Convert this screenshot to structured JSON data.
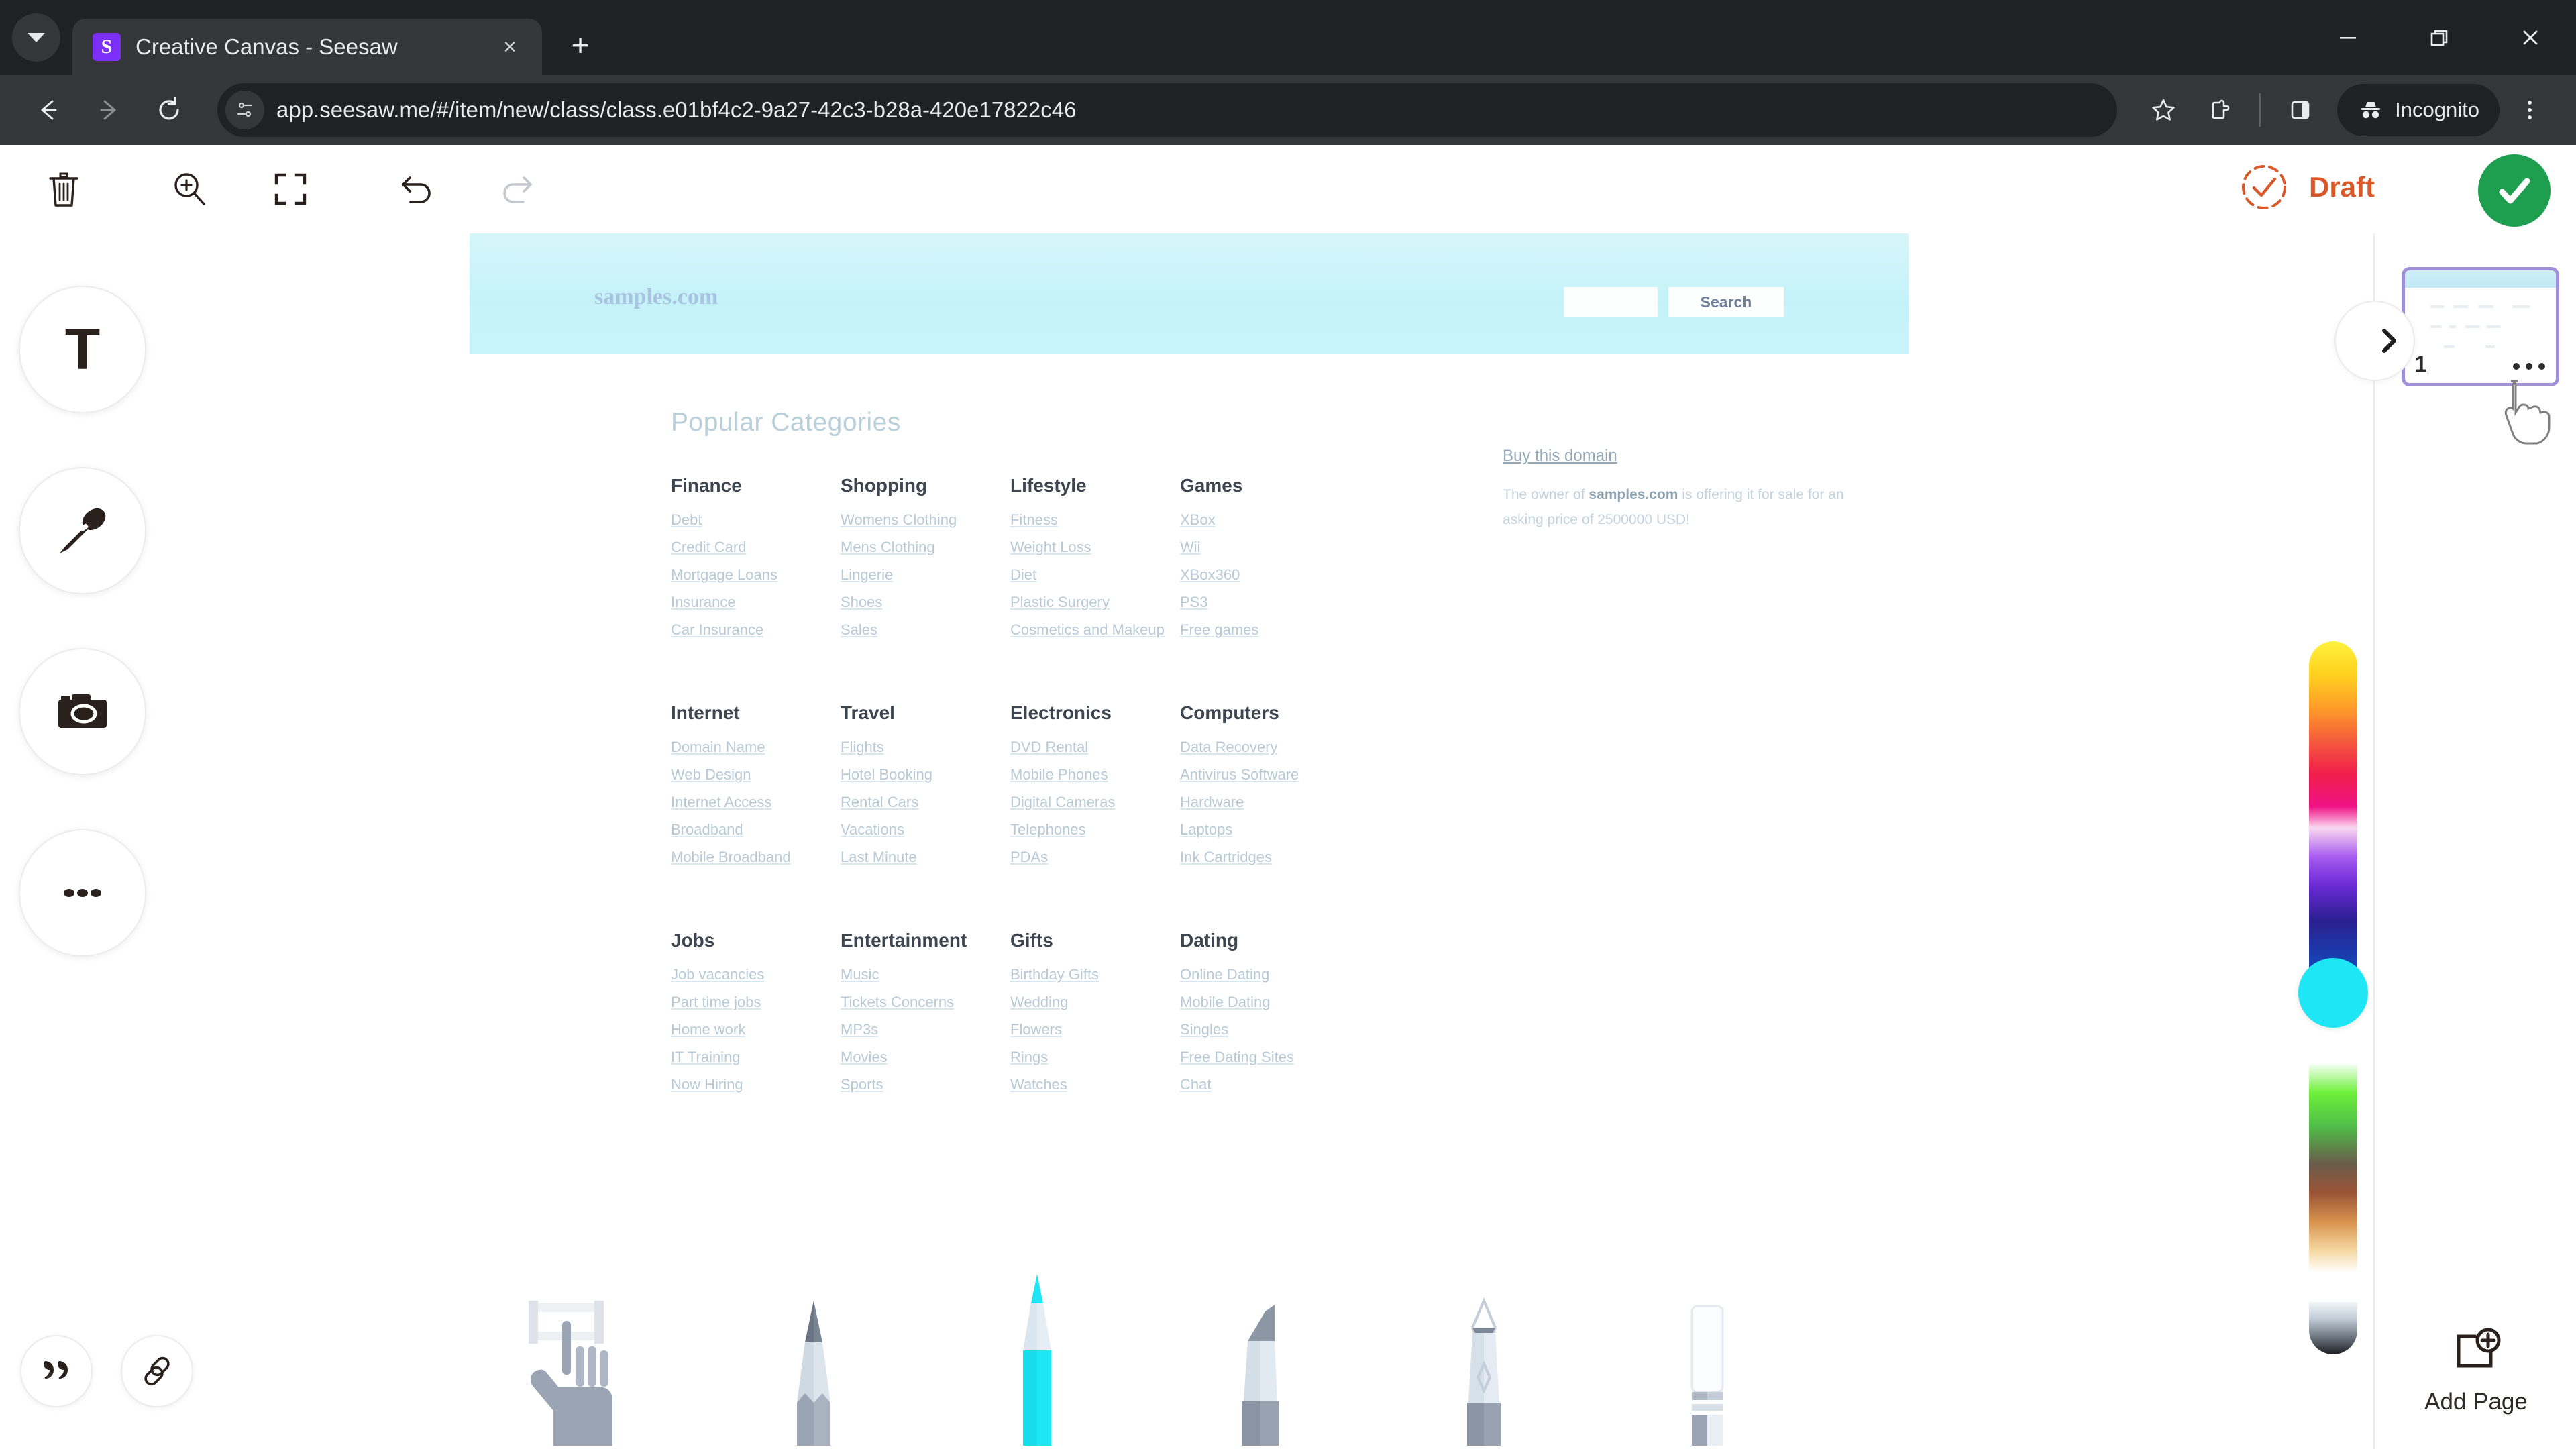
{
  "browser": {
    "tab": {
      "title": "Creative Canvas - Seesaw",
      "favicon_letter": "S",
      "favicon_name": "seesaw-logo"
    },
    "new_tab_label": "+",
    "close_label": "×",
    "url": "app.seesaw.me/#/item/new/class/class.e01bf4c2-9a27-42c3-b28a-420e17822c46",
    "profile_label": "Incognito",
    "window": {
      "minimize": "—",
      "maximize": "❐",
      "close": "✕"
    }
  },
  "app_toolbar": {
    "status_label": "Draft",
    "status_color": "#d95829",
    "submit_color": "#1e9e4f",
    "tools": [
      {
        "name": "delete-icon"
      },
      {
        "name": "zoom-in-icon"
      },
      {
        "name": "fit-screen-icon"
      },
      {
        "name": "undo-icon"
      },
      {
        "name": "redo-icon"
      }
    ]
  },
  "left_rail": {
    "items": [
      {
        "name": "text-tool",
        "icon": "text-icon",
        "glyph": "T"
      },
      {
        "name": "voice-tool",
        "icon": "microphone-icon"
      },
      {
        "name": "photo-tool",
        "icon": "camera-icon"
      },
      {
        "name": "more-tools",
        "icon": "ellipsis-icon"
      }
    ],
    "bottom": [
      {
        "name": "caption-tool",
        "icon": "quote-icon"
      },
      {
        "name": "link-tool",
        "icon": "link-icon"
      }
    ]
  },
  "canvas": {
    "document": {
      "logo": "samples.com",
      "search_button": "Search",
      "search_input_value": "",
      "heading": "Popular Categories",
      "groups": [
        {
          "title": "Finance",
          "links": [
            "Debt",
            "Credit Card",
            "Mortgage Loans",
            "Insurance",
            "Car Insurance"
          ]
        },
        {
          "title": "Shopping",
          "links": [
            "Womens Clothing",
            "Mens Clothing",
            "Lingerie",
            "Shoes",
            "Sales"
          ]
        },
        {
          "title": "Lifestyle",
          "links": [
            "Fitness",
            "Weight Loss",
            "Diet",
            "Plastic Surgery",
            "Cosmetics and Makeup"
          ]
        },
        {
          "title": "Games",
          "links": [
            "XBox",
            "Wii",
            "XBox360",
            "PS3",
            "Free games"
          ]
        },
        {
          "title": "Internet",
          "links": [
            "Domain Name",
            "Web Design",
            "Internet Access",
            "Broadband",
            "Mobile Broadband"
          ]
        },
        {
          "title": "Travel",
          "links": [
            "Flights",
            "Hotel Booking",
            "Rental Cars",
            "Vacations",
            "Last Minute"
          ]
        },
        {
          "title": "Electronics",
          "links": [
            "DVD Rental",
            "Mobile Phones",
            "Digital Cameras",
            "Telephones",
            "PDAs"
          ]
        },
        {
          "title": "Computers",
          "links": [
            "Data Recovery",
            "Antivirus Software",
            "Hardware",
            "Laptops",
            "Ink Cartridges"
          ]
        },
        {
          "title": "Jobs",
          "links": [
            "Job vacancies",
            "Part time jobs",
            "Home work",
            "IT Training",
            "Now Hiring"
          ]
        },
        {
          "title": "Entertainment",
          "links": [
            "Music",
            "Tickets Concerns",
            "MP3s",
            "Movies",
            "Sports"
          ]
        },
        {
          "title": "Gifts",
          "links": [
            "Birthday Gifts",
            "Wedding",
            "Flowers",
            "Rings",
            "Watches"
          ]
        },
        {
          "title": "Dating",
          "links": [
            "Online Dating",
            "Mobile Dating",
            "Singles",
            "Free Dating Sites",
            "Chat"
          ]
        }
      ],
      "buy": {
        "title": "Buy this domain",
        "text_before": "The owner of ",
        "domain": "samples.com",
        "text_after": " is offering it for sale for an asking price of 2500000 USD!"
      }
    }
  },
  "pen_tray": {
    "selected": "pen",
    "tools": [
      {
        "name": "hand-tool",
        "icon": "hand-icon"
      },
      {
        "name": "pencil-tool",
        "icon": "pencil-icon"
      },
      {
        "name": "pen-tool",
        "icon": "pen-icon"
      },
      {
        "name": "marker-tool",
        "icon": "marker-icon"
      },
      {
        "name": "calligraphy-tool",
        "icon": "calligraphy-pen-icon"
      },
      {
        "name": "eraser-tool",
        "icon": "eraser-icon"
      }
    ]
  },
  "color_picker": {
    "selected_color": "#1fe6f5"
  },
  "pages_panel": {
    "collapse_glyph": "›",
    "pages": [
      {
        "number": "1",
        "menu_glyph": "···"
      }
    ],
    "add_page_label": "Add Page"
  }
}
